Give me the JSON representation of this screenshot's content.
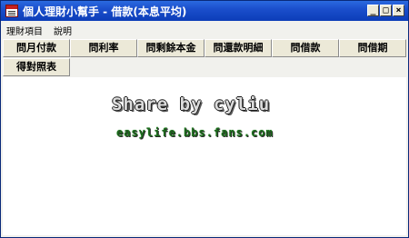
{
  "window": {
    "title": "個人理財小幫手 - 借款(本息平均)"
  },
  "title_controls": {
    "minimize": "_",
    "maximize": "□",
    "close": "×"
  },
  "menu": {
    "items": [
      "理財項目",
      "說明"
    ]
  },
  "toolbar": {
    "row1": [
      "問月付款",
      "問利率",
      "問剩餘本金",
      "問還款明細",
      "問借款",
      "問借期"
    ],
    "row2": [
      "得對照表"
    ]
  },
  "content": {
    "watermark_line1": "Share by cyliu",
    "watermark_line2": "easylife.bbs.fans.com"
  },
  "colors": {
    "titlebar": "#1b4fcc",
    "watermark_green": "#1b6a1b"
  }
}
